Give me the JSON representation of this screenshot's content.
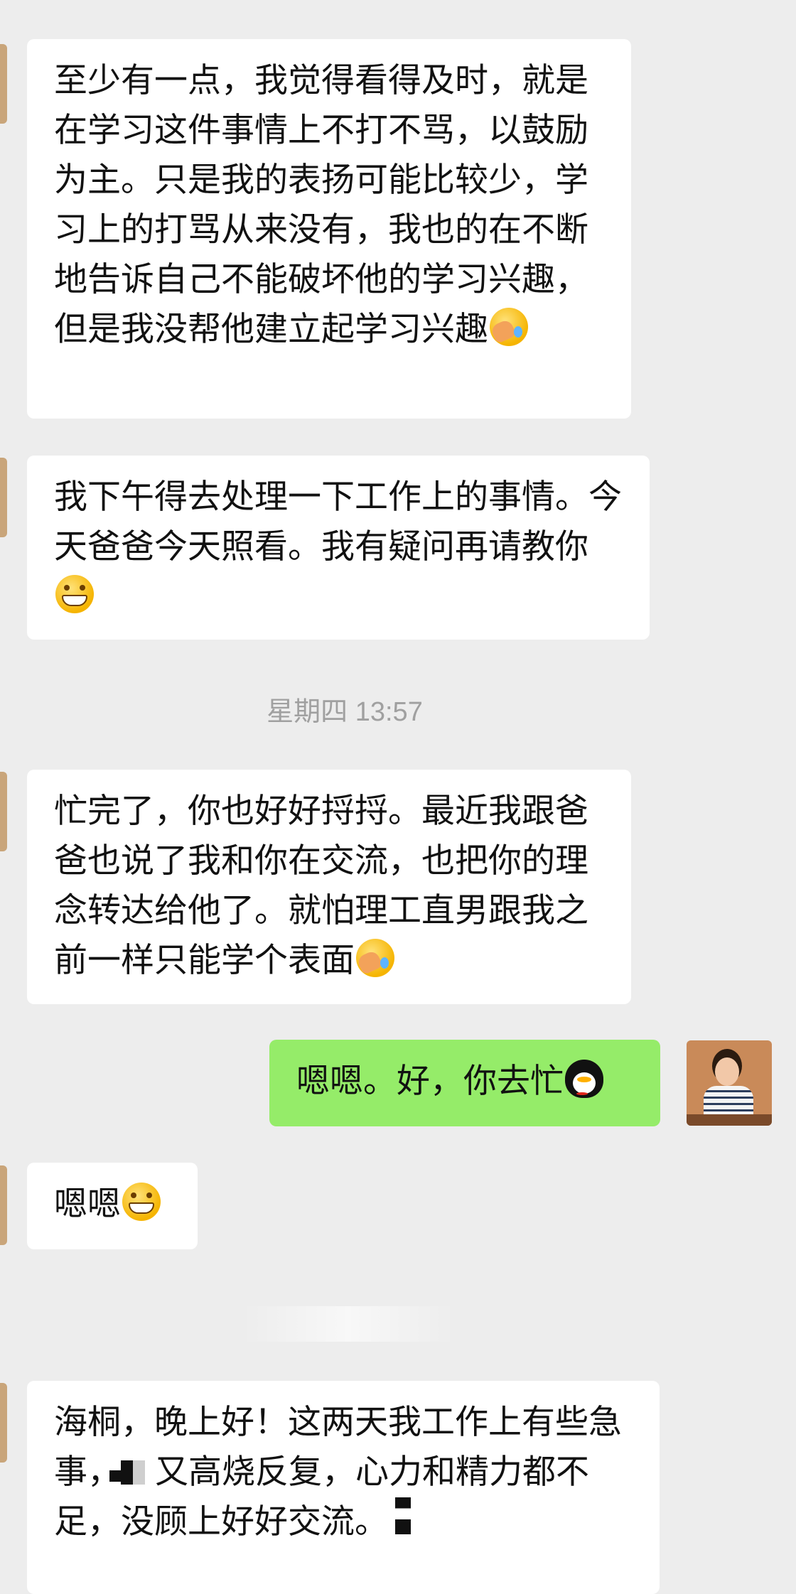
{
  "messages": [
    {
      "text": "至少有一点，我觉得看得及时，就是在学习这件事情上不打不骂，以鼓励为主。只是我的表扬可能比较少，学习上的打骂从来没有，我也的在不断地告诉自己不能破坏他的学习兴趣，但是我没帮他建立起学习兴趣",
      "emoji": "facepalm-emoji"
    },
    {
      "text": "我下午得去处理一下工作上的事情。今天爸爸今天照看。我有疑问再请教你",
      "emoji": "grin-emoji"
    },
    {
      "text": "忙完了，你也好好捋捋。最近我跟爸爸也说了我和你在交流，也把你的理念转达给他了。就怕理工直男跟我之前一样只能学个表面",
      "emoji": "facepalm-emoji"
    },
    {
      "text": "嗯嗯。好，你去忙",
      "emoji": "qq-penguin-emoji"
    },
    {
      "text": "嗯嗯",
      "emoji": "grin-emoji"
    },
    {
      "text_part1": "海桐，晚上好！这两天我工作上有些急事，",
      "text_part2": "又高烧反复，心力和精力都不足，没顾上好好交流。"
    }
  ],
  "timestamp": "星期四 13:57",
  "colors": {
    "background": "#ededed",
    "incoming_bubble": "#ffffff",
    "outgoing_bubble": "#95ec69",
    "timestamp_text": "#a0a0a0"
  }
}
